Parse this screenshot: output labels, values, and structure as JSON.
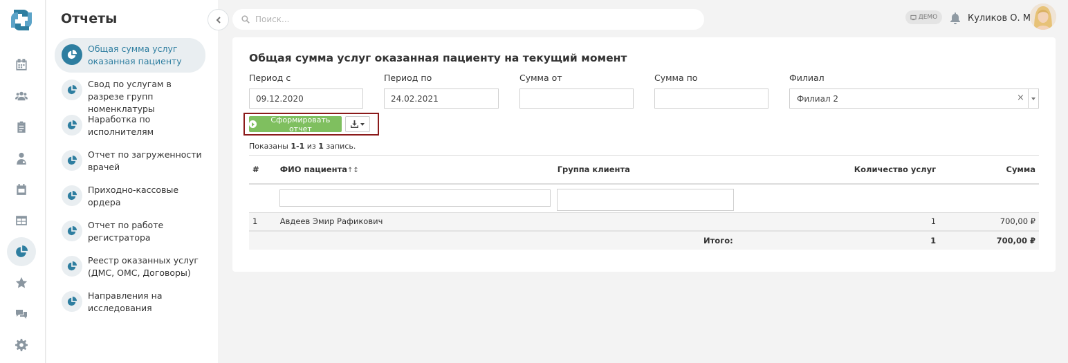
{
  "rail": {
    "items": [
      {
        "name": "calendar-icon"
      },
      {
        "name": "patients-icon"
      },
      {
        "name": "clipboard-icon"
      },
      {
        "name": "doctor-icon"
      },
      {
        "name": "schedule-icon"
      },
      {
        "name": "table-icon"
      },
      {
        "name": "reports-icon",
        "active": true
      },
      {
        "name": "star-icon"
      },
      {
        "name": "chat-icon"
      },
      {
        "name": "settings-icon"
      }
    ]
  },
  "menu": {
    "title": "Отчеты",
    "items": [
      {
        "label": "Общая сумма услуг оказанная пациенту",
        "active": true
      },
      {
        "label": "Свод по услугам в разрезе групп номенклатуры"
      },
      {
        "label": "Наработка по исполнителям"
      },
      {
        "label": "Отчет по загруженности врачей"
      },
      {
        "label": "Приходно-кассовые ордера"
      },
      {
        "label": "Отчет по работе регистратора"
      },
      {
        "label": "Реестр оказанных услуг (ДМС, ОМС, Договоры)"
      },
      {
        "label": "Направления на исследования"
      }
    ]
  },
  "topbar": {
    "search_placeholder": "Поиск...",
    "demo_badge": "ДЕМО",
    "user_name": "Куликов О. М."
  },
  "report": {
    "title": "Общая сумма услуг оказанная пациенту на текущий момент",
    "filters": {
      "period_from_label": "Период с",
      "period_from_value": "09.12.2020",
      "period_to_label": "Период по",
      "period_to_value": "24.02.2021",
      "sum_from_label": "Сумма от",
      "sum_from_value": "",
      "sum_to_label": "Сумма по",
      "sum_to_value": "",
      "branch_label": "Филиал",
      "branch_value": "Филиал 2",
      "branch_clear": "×"
    },
    "generate_button": "Сформировать отчет",
    "summary": {
      "prefix": "Показаны ",
      "range": "1-1",
      "middle": " из ",
      "total": "1",
      "suffix": " запись."
    },
    "table": {
      "headers": {
        "num": "#",
        "patient": "ФИО пациента",
        "sort_indicator": "↑↕",
        "group": "Группа клиента",
        "count": "Количество услуг",
        "sum": "Сумма"
      },
      "rows": [
        {
          "num": "1",
          "patient": "Авдеев Эмир Рафикович",
          "group": "",
          "count": "1",
          "sum": "700,00 ₽"
        }
      ],
      "totals": {
        "label": "Итого:",
        "count": "1",
        "sum": "700,00 ₽"
      }
    }
  }
}
